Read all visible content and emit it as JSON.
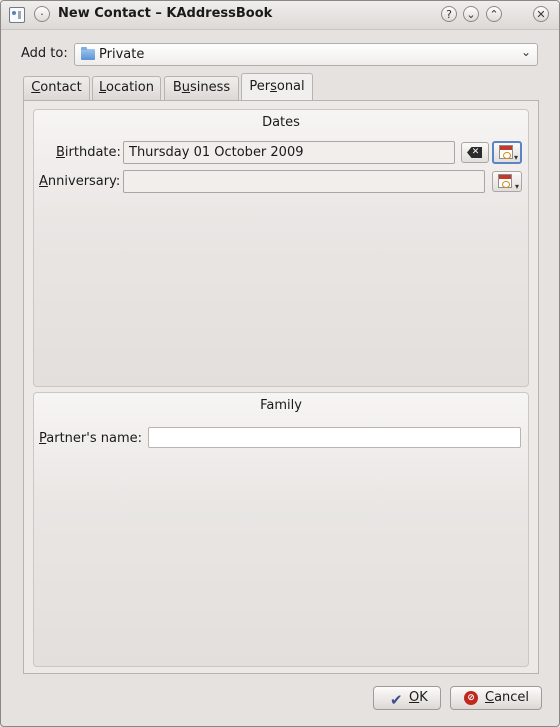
{
  "window": {
    "title": "New Contact – KAddressBook",
    "buttons": [
      "?",
      "⌄",
      "⌃",
      "✕"
    ]
  },
  "addto": {
    "label": "Add to:",
    "value": "Private"
  },
  "tabs": [
    {
      "pre": "",
      "u": "C",
      "post": "ontact",
      "active": false
    },
    {
      "pre": "",
      "u": "L",
      "post": "ocation",
      "active": false
    },
    {
      "pre": "B",
      "u": "u",
      "post": "siness",
      "active": false
    },
    {
      "pre": "Per",
      "u": "s",
      "post": "onal",
      "active": true
    }
  ],
  "dates": {
    "title": "Dates",
    "birthdate_label_u": "B",
    "birthdate_label_rest": "irthdate:",
    "birthdate_value": "Thursday 01 October 2009",
    "anniversary_label_u": "A",
    "anniversary_label_rest": "nniversary:",
    "anniversary_value": ""
  },
  "family": {
    "title": "Family",
    "partner_label_u": "P",
    "partner_label_rest": "artner's name:",
    "partner_value": ""
  },
  "footer": {
    "ok_u": "O",
    "ok_rest": "K",
    "cancel_u": "C",
    "cancel_rest": "ancel"
  },
  "colors": {
    "focus_border": "#5b84c5",
    "cancel_red": "#c0281d"
  }
}
